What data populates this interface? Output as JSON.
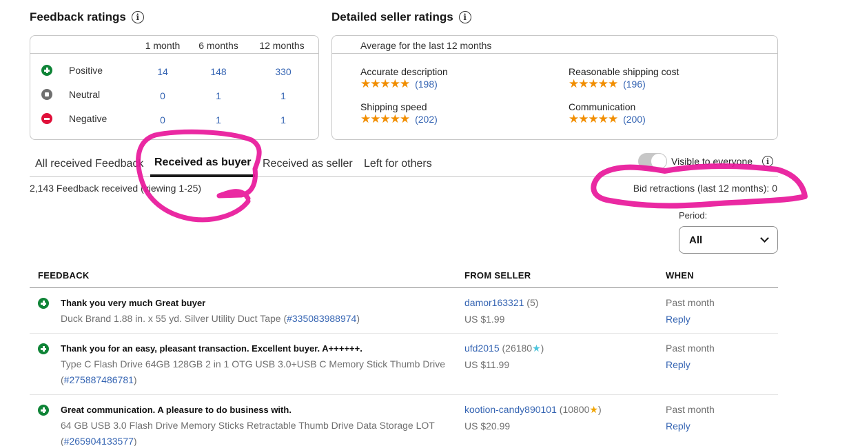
{
  "feedback_ratings": {
    "title": "Feedback ratings",
    "info_icon": "info-icon",
    "columns": [
      "1 month",
      "6 months",
      "12 months"
    ],
    "rows": [
      {
        "label": "Positive",
        "icon": "positive-icon",
        "values": [
          "14",
          "148",
          "330"
        ]
      },
      {
        "label": "Neutral",
        "icon": "neutral-icon",
        "values": [
          "0",
          "1",
          "1"
        ]
      },
      {
        "label": "Negative",
        "icon": "negative-icon",
        "values": [
          "0",
          "1",
          "1"
        ]
      }
    ]
  },
  "detailed_seller_ratings": {
    "title": "Detailed seller ratings",
    "subtitle": "Average for the last 12 months",
    "items": [
      {
        "label": "Accurate description",
        "stars": 5,
        "stars_glyph": "★★★★★",
        "count": "(198)"
      },
      {
        "label": "Reasonable shipping cost",
        "stars": 5,
        "stars_glyph": "★★★★★",
        "count": "(196)"
      },
      {
        "label": "Shipping speed",
        "stars": 5,
        "stars_glyph": "★★★★★",
        "count": "(202)"
      },
      {
        "label": "Communication",
        "stars": 5,
        "stars_glyph": "★★★★★",
        "count": "(200)"
      }
    ]
  },
  "tabs": [
    {
      "label": "All received Feedback",
      "active": false
    },
    {
      "label": "Received as buyer",
      "active": true
    },
    {
      "label": "Received as seller",
      "active": false
    },
    {
      "label": "Left for others",
      "active": false
    }
  ],
  "visibility": {
    "label": "Visible to everyone",
    "toggle_on": false
  },
  "summary": {
    "feedback_count": "2,143 Feedback received (viewing 1-25)",
    "bid_retractions": "Bid retractions (last 12 months): 0"
  },
  "period": {
    "label": "Period:",
    "selected": "All"
  },
  "table": {
    "headers": {
      "feedback": "FEEDBACK",
      "from_seller": "FROM SELLER",
      "when": "WHEN"
    },
    "rows": [
      {
        "rating": "positive",
        "comment": "Thank you very much Great buyer",
        "item_text": "Duck Brand 1.88 in. x 55 yd. Silver Utility Duct Tape (",
        "item_number": "#335083988974",
        "item_close": ")",
        "seller": "damor163321",
        "seller_score": "(5)",
        "seller_star": "",
        "price": "US $1.99",
        "when": "Past month",
        "reply": "Reply"
      },
      {
        "rating": "positive",
        "comment": "Thank you for an easy, pleasant transaction. Excellent buyer. A++++++.",
        "item_text": "Type C Flash Drive 64GB 128GB 2 in 1 OTG USB 3.0+USB C Memory Stick Thumb Drive",
        "item_open": "(",
        "item_number": "#275887486781",
        "item_close": ")",
        "seller": "ufd2015",
        "seller_score_open": "(26180",
        "seller_star": "turquoise-shooting-star",
        "seller_score_close": ")",
        "price": "US $11.99",
        "when": "Past month",
        "reply": "Reply"
      },
      {
        "rating": "positive",
        "comment": "Great communication. A pleasure to do business with.",
        "item_text": "64 GB USB 3.0 Flash Drive Memory Sticks Retractable Thumb Drive Data Storage LOT",
        "item_open": "(",
        "item_number": "#265904133577",
        "item_close": ")",
        "seller": "kootion-candy890101",
        "seller_score_open": "(10800",
        "seller_star": "gold-shooting-star",
        "seller_score_close": ")",
        "price": "US $20.99",
        "when": "Past month",
        "reply": "Reply"
      }
    ]
  },
  "annotations": {
    "color": "#e8179a"
  },
  "glyphs": {
    "star": "★",
    "info": "i"
  }
}
